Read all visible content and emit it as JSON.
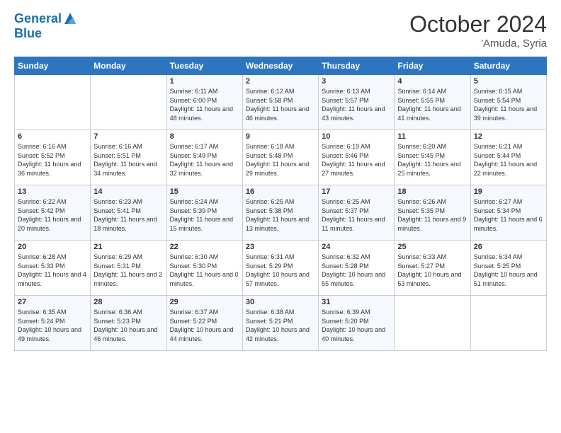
{
  "header": {
    "logo_line1": "General",
    "logo_line2": "Blue",
    "month": "October 2024",
    "location": "'Amuda, Syria"
  },
  "days_of_week": [
    "Sunday",
    "Monday",
    "Tuesday",
    "Wednesday",
    "Thursday",
    "Friday",
    "Saturday"
  ],
  "weeks": [
    [
      {
        "day": "",
        "info": ""
      },
      {
        "day": "",
        "info": ""
      },
      {
        "day": "1",
        "info": "Sunrise: 6:11 AM\nSunset: 6:00 PM\nDaylight: 11 hours and 48 minutes."
      },
      {
        "day": "2",
        "info": "Sunrise: 6:12 AM\nSunset: 5:58 PM\nDaylight: 11 hours and 46 minutes."
      },
      {
        "day": "3",
        "info": "Sunrise: 6:13 AM\nSunset: 5:57 PM\nDaylight: 11 hours and 43 minutes."
      },
      {
        "day": "4",
        "info": "Sunrise: 6:14 AM\nSunset: 5:55 PM\nDaylight: 11 hours and 41 minutes."
      },
      {
        "day": "5",
        "info": "Sunrise: 6:15 AM\nSunset: 5:54 PM\nDaylight: 11 hours and 39 minutes."
      }
    ],
    [
      {
        "day": "6",
        "info": "Sunrise: 6:16 AM\nSunset: 5:52 PM\nDaylight: 11 hours and 36 minutes."
      },
      {
        "day": "7",
        "info": "Sunrise: 6:16 AM\nSunset: 5:51 PM\nDaylight: 11 hours and 34 minutes."
      },
      {
        "day": "8",
        "info": "Sunrise: 6:17 AM\nSunset: 5:49 PM\nDaylight: 11 hours and 32 minutes."
      },
      {
        "day": "9",
        "info": "Sunrise: 6:18 AM\nSunset: 5:48 PM\nDaylight: 11 hours and 29 minutes."
      },
      {
        "day": "10",
        "info": "Sunrise: 6:19 AM\nSunset: 5:46 PM\nDaylight: 11 hours and 27 minutes."
      },
      {
        "day": "11",
        "info": "Sunrise: 6:20 AM\nSunset: 5:45 PM\nDaylight: 11 hours and 25 minutes."
      },
      {
        "day": "12",
        "info": "Sunrise: 6:21 AM\nSunset: 5:44 PM\nDaylight: 11 hours and 22 minutes."
      }
    ],
    [
      {
        "day": "13",
        "info": "Sunrise: 6:22 AM\nSunset: 5:42 PM\nDaylight: 11 hours and 20 minutes."
      },
      {
        "day": "14",
        "info": "Sunrise: 6:23 AM\nSunset: 5:41 PM\nDaylight: 11 hours and 18 minutes."
      },
      {
        "day": "15",
        "info": "Sunrise: 6:24 AM\nSunset: 5:39 PM\nDaylight: 11 hours and 15 minutes."
      },
      {
        "day": "16",
        "info": "Sunrise: 6:25 AM\nSunset: 5:38 PM\nDaylight: 11 hours and 13 minutes."
      },
      {
        "day": "17",
        "info": "Sunrise: 6:25 AM\nSunset: 5:37 PM\nDaylight: 11 hours and 11 minutes."
      },
      {
        "day": "18",
        "info": "Sunrise: 6:26 AM\nSunset: 5:35 PM\nDaylight: 11 hours and 9 minutes."
      },
      {
        "day": "19",
        "info": "Sunrise: 6:27 AM\nSunset: 5:34 PM\nDaylight: 11 hours and 6 minutes."
      }
    ],
    [
      {
        "day": "20",
        "info": "Sunrise: 6:28 AM\nSunset: 5:33 PM\nDaylight: 11 hours and 4 minutes."
      },
      {
        "day": "21",
        "info": "Sunrise: 6:29 AM\nSunset: 5:31 PM\nDaylight: 11 hours and 2 minutes."
      },
      {
        "day": "22",
        "info": "Sunrise: 6:30 AM\nSunset: 5:30 PM\nDaylight: 11 hours and 0 minutes."
      },
      {
        "day": "23",
        "info": "Sunrise: 6:31 AM\nSunset: 5:29 PM\nDaylight: 10 hours and 57 minutes."
      },
      {
        "day": "24",
        "info": "Sunrise: 6:32 AM\nSunset: 5:28 PM\nDaylight: 10 hours and 55 minutes."
      },
      {
        "day": "25",
        "info": "Sunrise: 6:33 AM\nSunset: 5:27 PM\nDaylight: 10 hours and 53 minutes."
      },
      {
        "day": "26",
        "info": "Sunrise: 6:34 AM\nSunset: 5:25 PM\nDaylight: 10 hours and 51 minutes."
      }
    ],
    [
      {
        "day": "27",
        "info": "Sunrise: 6:35 AM\nSunset: 5:24 PM\nDaylight: 10 hours and 49 minutes."
      },
      {
        "day": "28",
        "info": "Sunrise: 6:36 AM\nSunset: 5:23 PM\nDaylight: 10 hours and 46 minutes."
      },
      {
        "day": "29",
        "info": "Sunrise: 6:37 AM\nSunset: 5:22 PM\nDaylight: 10 hours and 44 minutes."
      },
      {
        "day": "30",
        "info": "Sunrise: 6:38 AM\nSunset: 5:21 PM\nDaylight: 10 hours and 42 minutes."
      },
      {
        "day": "31",
        "info": "Sunrise: 6:39 AM\nSunset: 5:20 PM\nDaylight: 10 hours and 40 minutes."
      },
      {
        "day": "",
        "info": ""
      },
      {
        "day": "",
        "info": ""
      }
    ]
  ]
}
